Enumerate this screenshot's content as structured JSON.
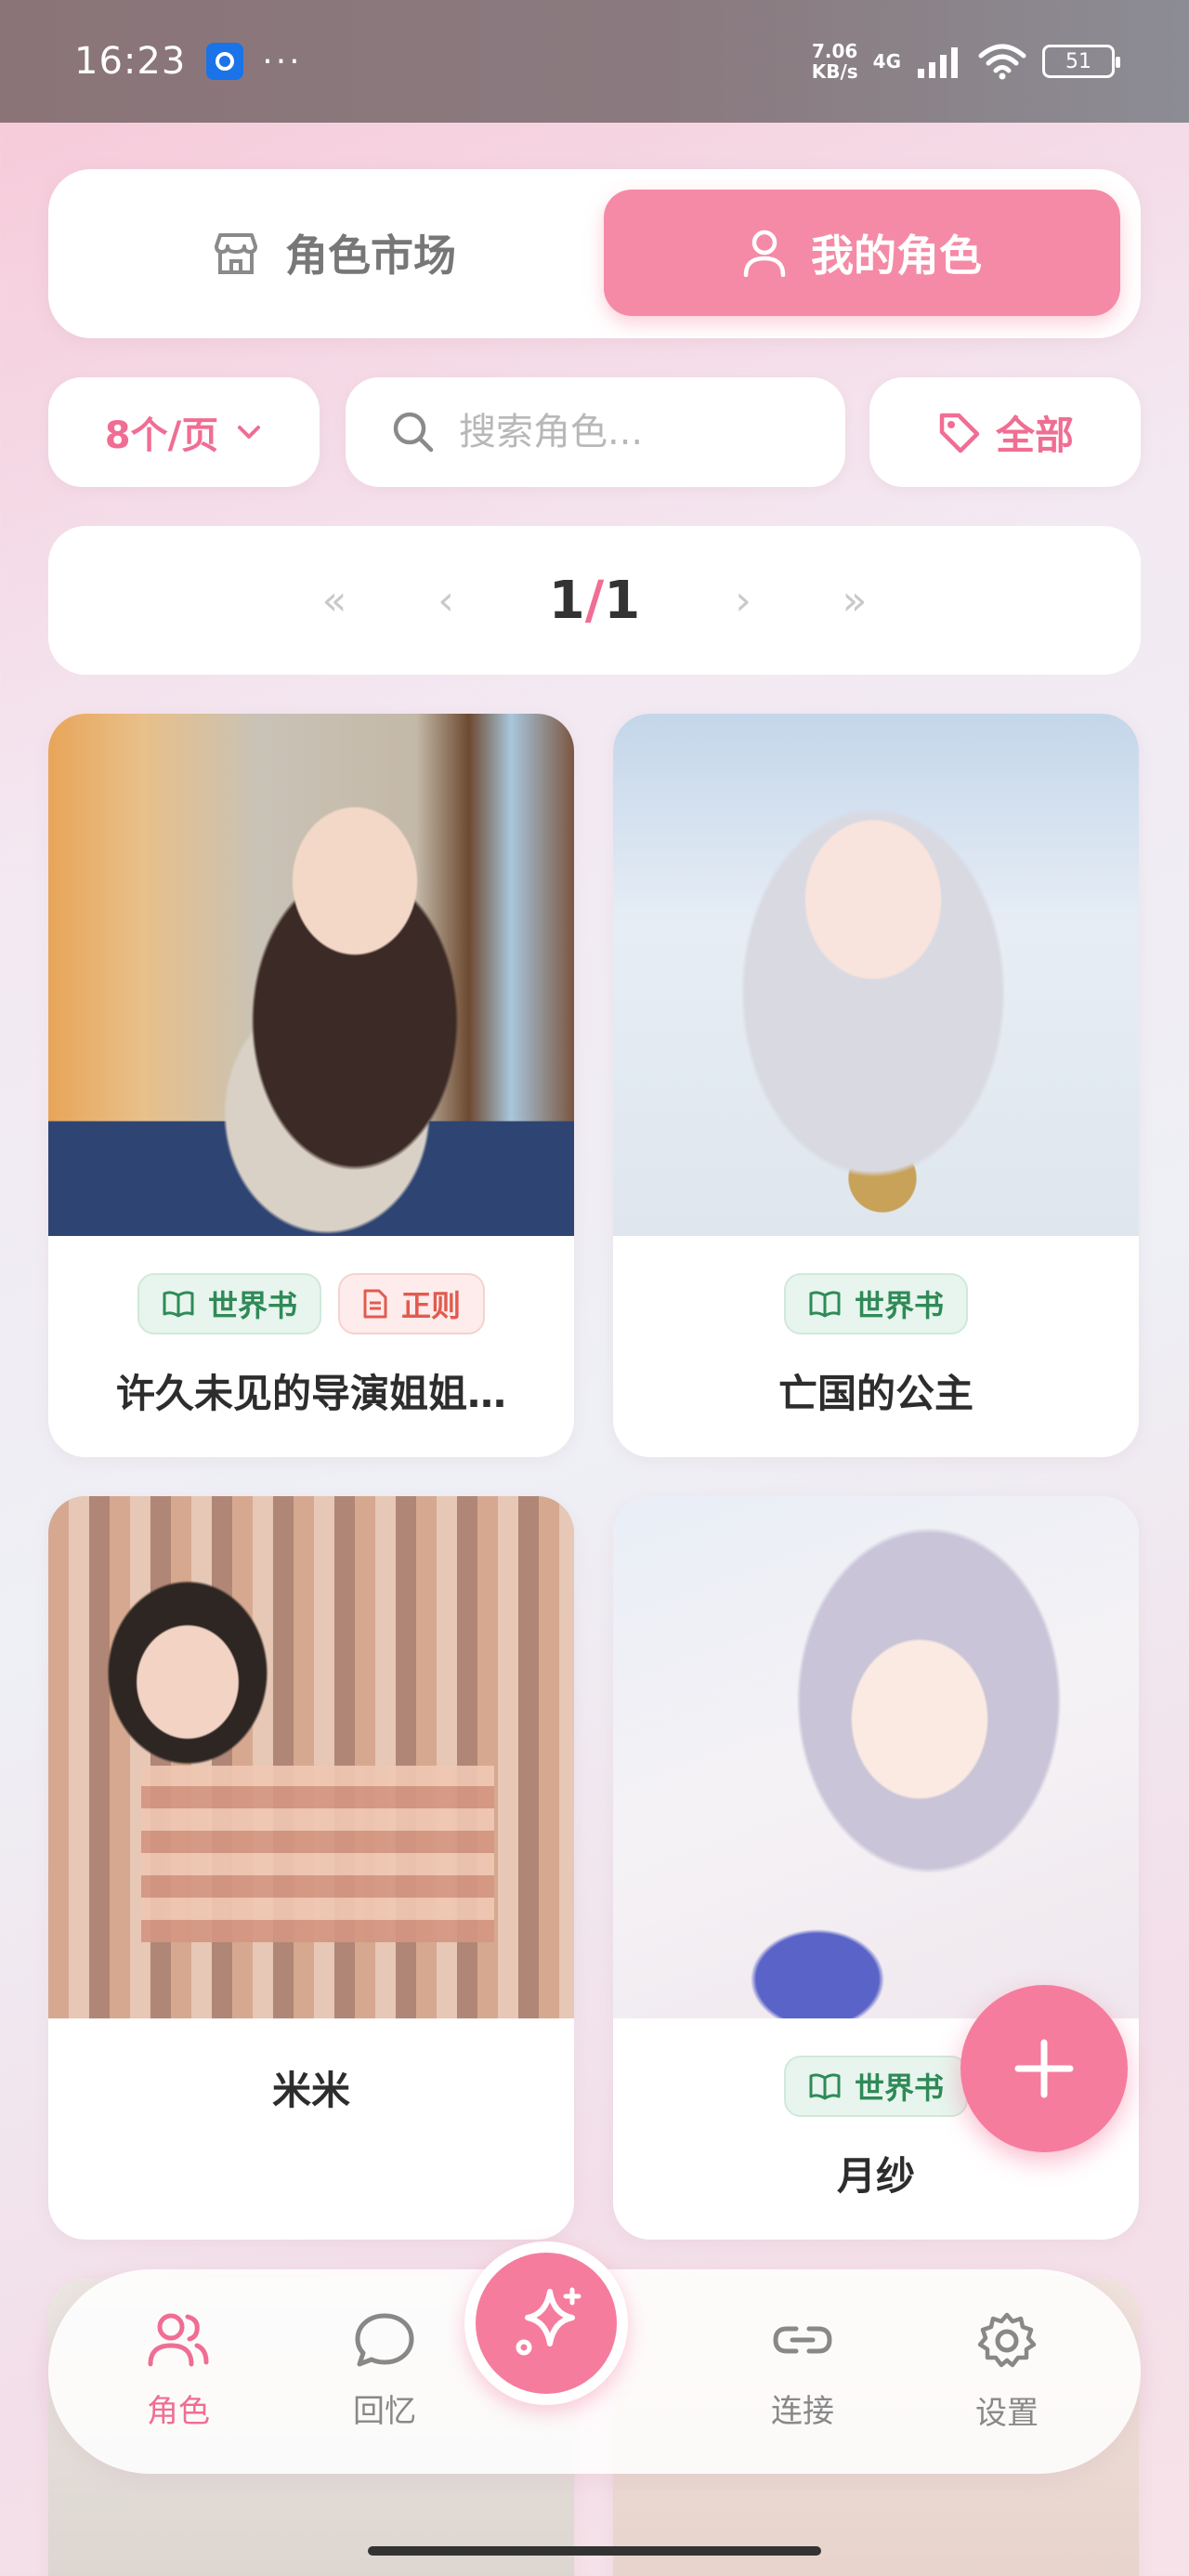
{
  "status_bar": {
    "time": "16:23",
    "dots": "···",
    "speed_top": "7.06",
    "speed_bottom": "KB/s",
    "network": "4G",
    "battery": "51"
  },
  "segmented": {
    "market_label": "角色市场",
    "mine_label": "我的角色",
    "active": "mine"
  },
  "filters": {
    "per_page_label": "8个/页",
    "search_placeholder": "搜索角色...",
    "search_value": "",
    "tag_label": "全部"
  },
  "pagination": {
    "current": "1",
    "separator": "/",
    "total": "1",
    "first": "«",
    "prev": "‹",
    "next": "›",
    "last": "»"
  },
  "tag_labels": {
    "world_book": "世界书",
    "regex": "正则"
  },
  "cards": [
    {
      "name": "许久未见的导演姐姐…",
      "tags": [
        "世界书",
        "正则"
      ]
    },
    {
      "name": "亡国的公主",
      "tags": [
        "世界书"
      ]
    },
    {
      "name": "米米",
      "tags": []
    },
    {
      "name": "月纱",
      "tags": [
        "世界书"
      ]
    }
  ],
  "nav": {
    "roles": "角色",
    "memory": "回忆",
    "connect": "连接",
    "settings": "设置",
    "active": "roles"
  },
  "colors": {
    "accent": "#f57c9d",
    "accent_text": "#f06d93",
    "world_tag": "#2f8a57",
    "regex_tag": "#e15b4f"
  }
}
